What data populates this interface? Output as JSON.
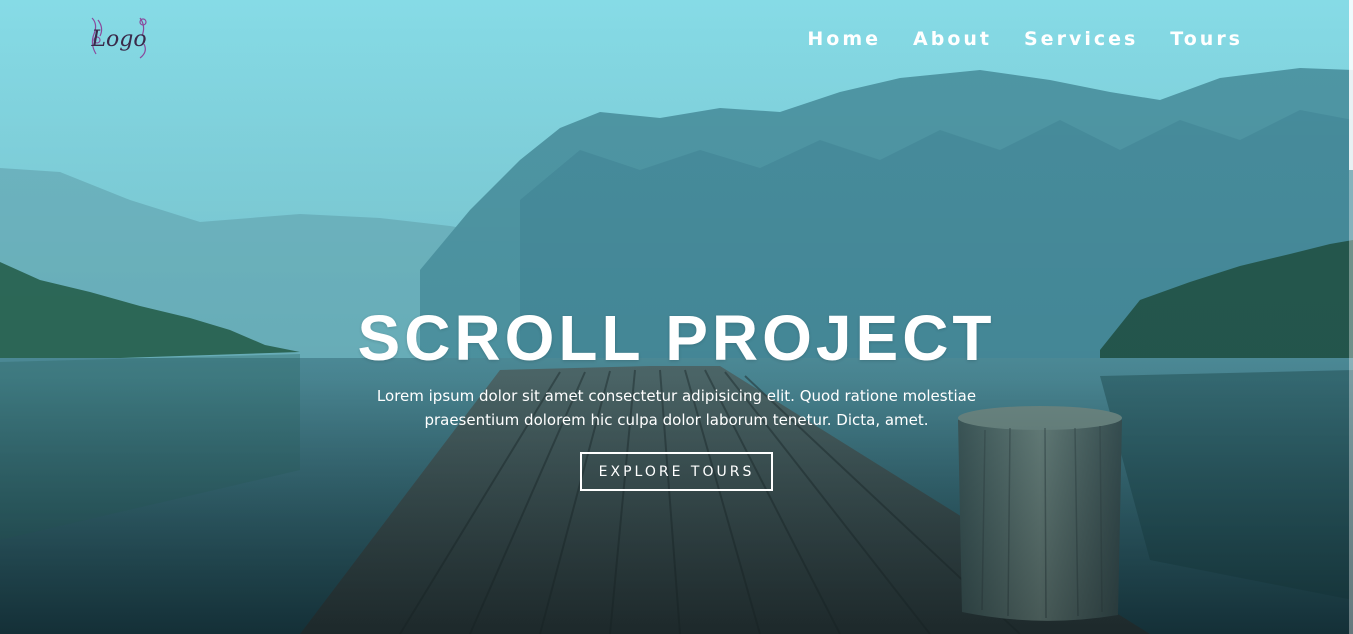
{
  "logo": {
    "text": "Logo"
  },
  "nav": {
    "items": [
      {
        "label": "Home"
      },
      {
        "label": "About"
      },
      {
        "label": "Services"
      },
      {
        "label": "Tours"
      }
    ]
  },
  "banner": {
    "title": "SCROLL PROJECT",
    "description": "Lorem ipsum dolor sit amet consectetur adipisicing elit. Quod ratione molestiae praesentium dolorem hic culpa dolor laborum tenetur. Dicta, amet.",
    "button_label": "EXPLORE TOURS"
  },
  "colors": {
    "overlay": "#59c8d8",
    "text": "#ffffff",
    "logo_purple": "#8b4a9c"
  }
}
